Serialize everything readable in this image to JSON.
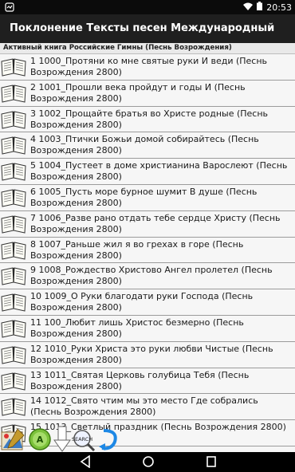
{
  "status": {
    "time": "20:53"
  },
  "app": {
    "title": "Поклонение Тексты песен Международный"
  },
  "subheader": {
    "text": "Активный книга Российские Гимны (Песнь Возрождения)"
  },
  "songs": [
    {
      "label": "1 1000_Протяни ко мне святые руки И веди (Песнь Возрождения 2800)"
    },
    {
      "label": "2 1001_Прошли века  пройдут и годы И (Песнь Возрождения 2800)"
    },
    {
      "label": "3 1002_Прощайте братья во Христе родные (Песнь Возрождения 2800)"
    },
    {
      "label": "4 1003_Птички Божьи домой собирайтесь (Песнь Возрождения 2800)"
    },
    {
      "label": "5 1004_Пустеет в доме христианина Варослеют (Песнь Возрождения 2800)"
    },
    {
      "label": "6 1005_Пусть море бурное шумит В душе (Песнь Возрождения 2800)"
    },
    {
      "label": "7 1006_Разве рано отдать тебе сердце Христу (Песнь Возрождения 2800)"
    },
    {
      "label": "8 1007_Раньше жил я во грехах в горе (Песнь Возрождения 2800)"
    },
    {
      "label": "9 1008_Рождество Христово Ангел пролетел (Песнь Возрождения 2800)"
    },
    {
      "label": "10 1009_О Руки благодати  руки Господа (Песнь Возрождения 2800)"
    },
    {
      "label": "11 100_Любит лишь Христос безмерно (Песнь Возрождения 2800)"
    },
    {
      "label": "12 1010_Руки Христа  это руки любви Чистые (Песнь Возрождения 2800)"
    },
    {
      "label": "13 1011_Святая Церковь  голубица Тебя (Песнь Возрождения 2800)"
    },
    {
      "label": "14 1012_Свято чтим мы это место Где собрались (Песнь Возрождения 2800)"
    },
    {
      "label": "15 1013_Светлый праздник (Песнь Возрождения 2800)"
    }
  ],
  "tools": {
    "search_label": "SEARCH"
  }
}
